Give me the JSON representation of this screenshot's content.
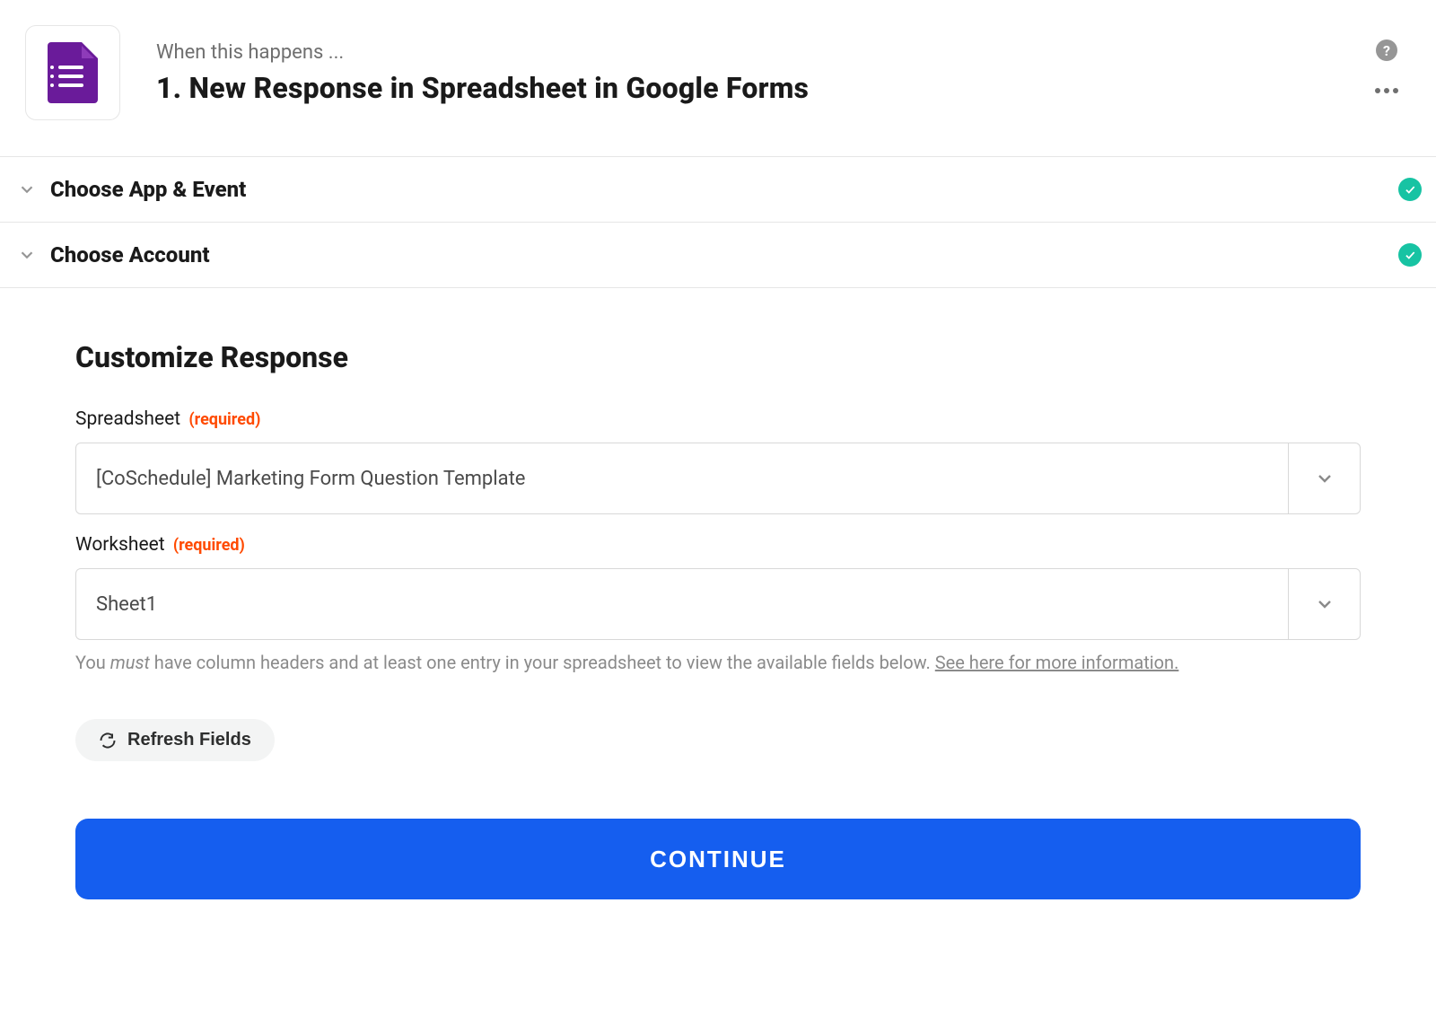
{
  "header": {
    "pre_title": "When this happens ...",
    "title": "1. New Response in Spreadsheet in Google Forms"
  },
  "sections": {
    "app_event": {
      "label": "Choose App & Event",
      "complete": true
    },
    "account": {
      "label": "Choose Account",
      "complete": true
    }
  },
  "body": {
    "title": "Customize Response",
    "fields": {
      "spreadsheet": {
        "label": "Spreadsheet",
        "required_text": "(required)",
        "value": "[CoSchedule] Marketing Form Question Template"
      },
      "worksheet": {
        "label": "Worksheet",
        "required_text": "(required)",
        "value": "Sheet1"
      }
    },
    "hint_prefix": "You ",
    "hint_em": "must",
    "hint_rest": " have column headers and at least one entry in your spreadsheet to view the available fields below. ",
    "hint_link": "See here for more information.",
    "refresh_label": "Refresh Fields",
    "continue_label": "CONTINUE"
  }
}
